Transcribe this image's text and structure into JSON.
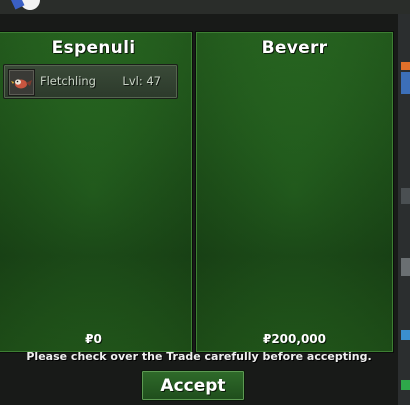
{
  "trade": {
    "left_panel": {
      "player_name": "Espenuli",
      "items": [
        {
          "name": "Fletchling",
          "level": "Lvl: 47",
          "icon": "fletchling-icon"
        }
      ],
      "money": "₽0"
    },
    "right_panel": {
      "player_name": "Beverr",
      "items": [],
      "money": "₽200,000"
    },
    "notice": "Please check over the Trade carefully before accepting.",
    "accept_label": "Accept"
  },
  "colors": {
    "panel_green": "#2f7a27",
    "button_green": "#2f6b2a",
    "window_bg": "#181a18"
  }
}
